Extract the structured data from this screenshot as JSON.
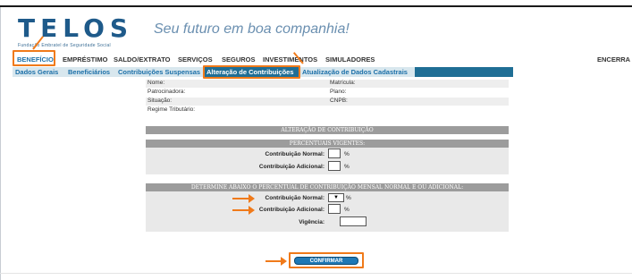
{
  "brand": {
    "logo": "TELOS",
    "logo_sub": "Fundação Embratel de Seguridade Social",
    "slogan": "Seu futuro em boa companhia!"
  },
  "main_menu": {
    "items": [
      "BENEFÍCIO",
      "EMPRÉSTIMO",
      "SALDO/EXTRATO",
      "SERVIÇOS",
      "SEGUROS",
      "INVESTIMENTOS",
      "SIMULADORES"
    ],
    "logout": "ENCERRA"
  },
  "sub_menu": {
    "items": [
      "Dados Gerais",
      "Beneficiários",
      "Contribuições Suspensas",
      "Alteração de Contribuições",
      "Atualização de Dados Cadastrais"
    ]
  },
  "info": {
    "nome": "Nome:",
    "matricula": "Matrícula:",
    "patrocinadora": "Patrocinadora:",
    "plano": "Plano:",
    "situacao": "Situação:",
    "cnpb": "CNPB:",
    "regime": "Regime Tributário:"
  },
  "section_title": "ALTERAÇÃO DE CONTRIBUIÇÃO",
  "current": {
    "title": "PERCENTUAIS VIGENTES:",
    "normal_label": "Contribuição Normal:",
    "additional_label": "Contribuição Adicional:",
    "pct": "%"
  },
  "new": {
    "title": "DETERMINE ABAIXO O PERCENTUAL DE CONTRIBUIÇÃO MENSAL NORMAL E OU ADICIONAL:",
    "normal_label": "Contribuição Normal:",
    "normal_select": "",
    "additional_label": "Contribuição Adicional:",
    "vigencia_label": "Vigência:",
    "pct": "%"
  },
  "confirm_label": "CONFIRMAR",
  "colors": {
    "accent": "#f07a1a",
    "brand_blue": "#1e5a8a",
    "submenu_bar": "#1f6e95",
    "button": "#1f78b5"
  }
}
